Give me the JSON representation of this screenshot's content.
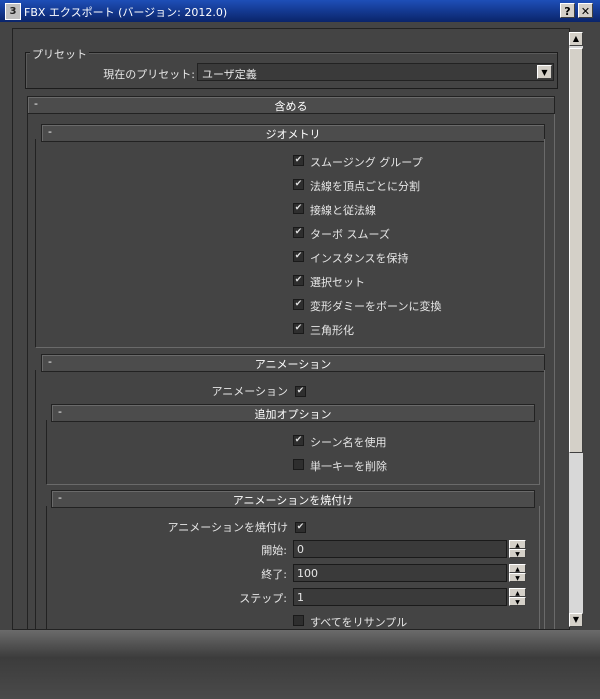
{
  "window": {
    "title": "FBX エクスポート (バージョン: 2012.0)",
    "help_label": "?",
    "close_label": "✕"
  },
  "preset": {
    "group_label": "プリセット",
    "current_label": "現在のプリセット:",
    "value": "ユーザ定義"
  },
  "include": {
    "title": "含める",
    "collapse": "-"
  },
  "geometry": {
    "title": "ジオメトリ",
    "collapse": "-",
    "options": [
      {
        "label": "スムージング グループ",
        "checked": true
      },
      {
        "label": "法線を頂点ごとに分割",
        "checked": true
      },
      {
        "label": "接線と従法線",
        "checked": true
      },
      {
        "label": "ターボ スムーズ",
        "checked": true
      },
      {
        "label": "インスタンスを保持",
        "checked": true
      },
      {
        "label": "選択セット",
        "checked": true
      },
      {
        "label": "変形ダミーをボーンに変換",
        "checked": true
      },
      {
        "label": "三角形化",
        "checked": true
      }
    ]
  },
  "animation": {
    "title": "アニメーション",
    "collapse": "-",
    "checkbox_label": "アニメーション",
    "checked": true,
    "extra": {
      "title": "追加オプション",
      "collapse": "-",
      "options": [
        {
          "label": "シーン名を使用",
          "checked": true
        },
        {
          "label": "単一キーを削除",
          "checked": false
        }
      ]
    },
    "bake": {
      "title": "アニメーションを焼付け",
      "collapse": "-",
      "checkbox_label": "アニメーションを焼付け",
      "checked": true,
      "start_label": "開始:",
      "start_value": "0",
      "end_label": "終了:",
      "end_value": "100",
      "step_label": "ステップ:",
      "step_value": "1",
      "resample_label": "すべてをリサンプル",
      "resample_checked": false
    }
  }
}
